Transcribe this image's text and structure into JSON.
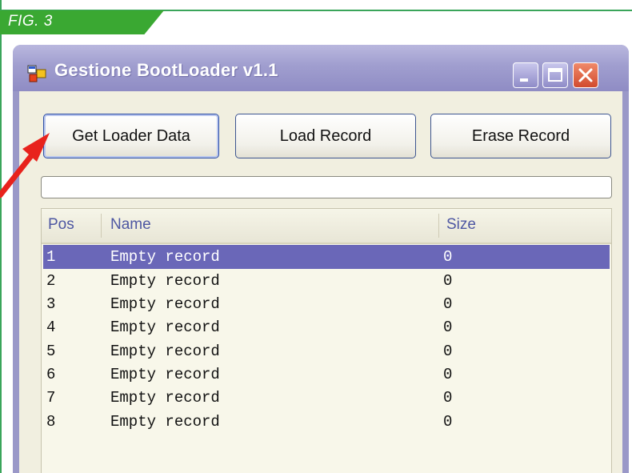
{
  "figure": {
    "label": "FIG. 3",
    "accent": "#3aa832"
  },
  "window": {
    "title": "Gestione BootLoader v1.1",
    "icons": [
      "app-icon",
      "minimize-icon",
      "maximize-icon",
      "close-icon"
    ],
    "titlebar_color": "#a09ecf",
    "selection_color": "#6a67b8"
  },
  "toolbar": {
    "get_loader_label": "Get Loader Data",
    "load_record_label": "Load Record",
    "erase_record_label": "Erase Record"
  },
  "progress": {
    "value": 0
  },
  "list": {
    "columns": {
      "pos": "Pos",
      "name": "Name",
      "size": "Size"
    },
    "rows": [
      {
        "pos": "1",
        "name": "Empty record",
        "size": "0"
      },
      {
        "pos": "2",
        "name": "Empty record",
        "size": "0"
      },
      {
        "pos": "3",
        "name": "Empty record",
        "size": "0"
      },
      {
        "pos": "4",
        "name": "Empty record",
        "size": "0"
      },
      {
        "pos": "5",
        "name": "Empty record",
        "size": "0"
      },
      {
        "pos": "6",
        "name": "Empty record",
        "size": "0"
      },
      {
        "pos": "7",
        "name": "Empty record",
        "size": "0"
      },
      {
        "pos": "8",
        "name": "Empty record",
        "size": "0"
      }
    ],
    "selected_index": 0
  },
  "annotation": {
    "arrow_color": "#e8221c"
  }
}
